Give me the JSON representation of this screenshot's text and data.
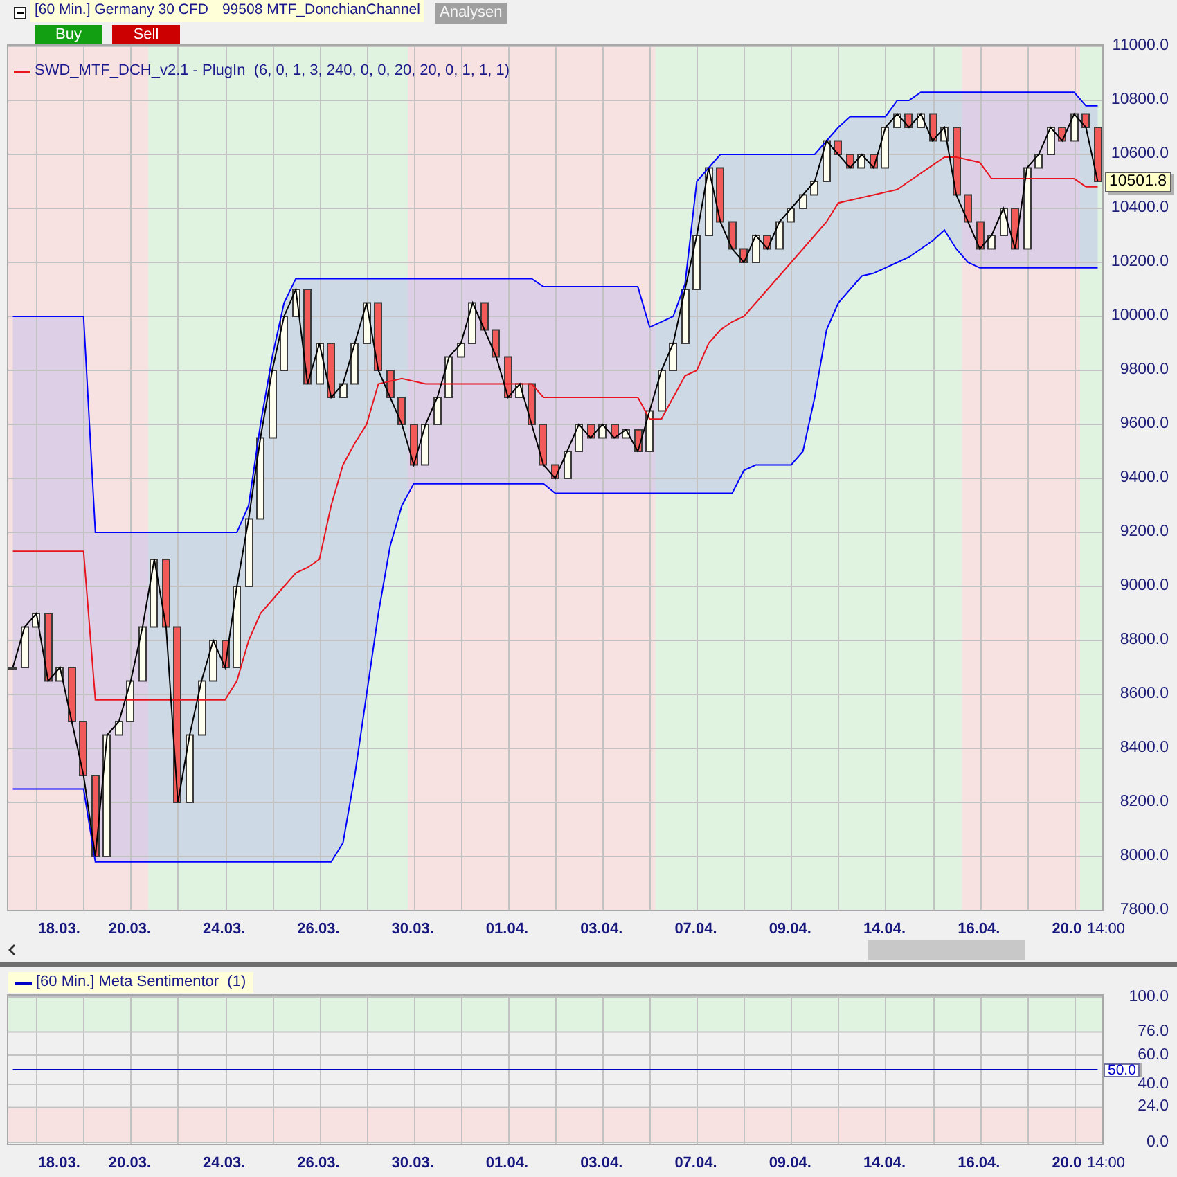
{
  "title_bar": {
    "instrument": "[60 Min.] Germany 30 CFD",
    "template": "99508 MTF_DonchianChannel",
    "analysis_button": "Analysen"
  },
  "order_buttons": [
    {
      "kind": "buy",
      "label": "Buy"
    },
    {
      "kind": "sell",
      "label": "Sell"
    }
  ],
  "price_chart": {
    "legend": "SWD_MTF_DCH_v2.1 - PlugIn  (6, 0, 1, 3, 240, 0, 0, 20, 20, 0, 1, 1, 1)",
    "last_price": "10501.8",
    "time_label": "14:00",
    "chart_data": {
      "type": "line",
      "grid": true,
      "categories": [
        null,
        null,
        null,
        null,
        "18.03.",
        null,
        null,
        null,
        null,
        null,
        "20.03.",
        null,
        null,
        null,
        null,
        null,
        null,
        null,
        "24.03.",
        null,
        null,
        null,
        null,
        null,
        null,
        null,
        "26.03.",
        null,
        null,
        null,
        null,
        null,
        null,
        null,
        "30.03.",
        null,
        null,
        null,
        null,
        null,
        null,
        null,
        "01.04.",
        null,
        null,
        null,
        null,
        null,
        null,
        null,
        "03.04.",
        null,
        null,
        null,
        null,
        null,
        null,
        null,
        "07.04.",
        null,
        null,
        null,
        null,
        null,
        null,
        null,
        "09.04.",
        null,
        null,
        null,
        null,
        null,
        null,
        null,
        "14.04.",
        null,
        null,
        null,
        null,
        null,
        null,
        null,
        "16.04.",
        null,
        null,
        null,
        null,
        null,
        null,
        null,
        "20.0",
        null,
        null
      ],
      "series": [
        {
          "values": [
            8700,
            8850,
            8900,
            8650,
            8700,
            8500,
            8300,
            8000,
            8450,
            8500,
            8650,
            8850,
            9100,
            8850,
            8200,
            8450,
            8650,
            8800,
            8700,
            9000,
            9250,
            9550,
            9800,
            10000,
            10100,
            9750,
            9900,
            9700,
            9750,
            9900,
            10050,
            9800,
            9700,
            9600,
            9450,
            9600,
            9700,
            9850,
            9900,
            10050,
            9950,
            9850,
            9700,
            9750,
            9600,
            9450,
            9400,
            9500,
            9600,
            9550,
            9600,
            9550,
            9580,
            9500,
            9650,
            9800,
            9900,
            10100,
            10300,
            10550,
            10350,
            10250,
            10200,
            10300,
            10250,
            10350,
            10400,
            10450,
            10500,
            10650,
            10600,
            10550,
            10600,
            10550,
            10700,
            10750,
            10700,
            10750,
            10650,
            10700,
            10450,
            10350,
            10250,
            10300,
            10400,
            10250,
            10550,
            10600,
            10700,
            10650,
            10750,
            10700,
            10500
          ]
        },
        {
          "color": "#0000ff",
          "values": [
            10000,
            10000,
            10000,
            10000,
            10000,
            10000,
            10000,
            9200,
            9200,
            9200,
            9200,
            9200,
            9200,
            9200,
            9200,
            9200,
            9200,
            9200,
            9200,
            9200,
            9300,
            9600,
            9850,
            10050,
            10140,
            10140,
            10140,
            10140,
            10140,
            10140,
            10140,
            10140,
            10140,
            10140,
            10140,
            10140,
            10140,
            10140,
            10140,
            10140,
            10140,
            10140,
            10140,
            10140,
            10140,
            10110,
            10110,
            10110,
            10110,
            10110,
            10110,
            10110,
            10110,
            10110,
            9960,
            9980,
            10000,
            10120,
            10500,
            10550,
            10600,
            10600,
            10600,
            10600,
            10600,
            10600,
            10600,
            10600,
            10600,
            10650,
            10700,
            10740,
            10740,
            10740,
            10740,
            10800,
            10800,
            10830,
            10830,
            10830,
            10830,
            10830,
            10830,
            10830,
            10830,
            10830,
            10830,
            10830,
            10830,
            10830,
            10830,
            10780,
            10780
          ]
        },
        {
          "color": "#e8141e",
          "values": [
            9130,
            9130,
            9130,
            9130,
            9130,
            9130,
            9130,
            8580,
            8580,
            8580,
            8580,
            8580,
            8580,
            8580,
            8580,
            8580,
            8580,
            8580,
            8580,
            8650,
            8800,
            8900,
            8950,
            9000,
            9050,
            9070,
            9100,
            9300,
            9450,
            9530,
            9600,
            9750,
            9760,
            9770,
            9760,
            9750,
            9750,
            9750,
            9750,
            9750,
            9750,
            9750,
            9750,
            9750,
            9750,
            9700,
            9700,
            9700,
            9700,
            9700,
            9700,
            9700,
            9700,
            9700,
            9620,
            9620,
            9700,
            9780,
            9800,
            9900,
            9950,
            9980,
            10000,
            10050,
            10100,
            10150,
            10200,
            10250,
            10300,
            10350,
            10420,
            10430,
            10440,
            10450,
            10460,
            10470,
            10500,
            10530,
            10560,
            10590,
            10590,
            10580,
            10570,
            10510,
            10510,
            10510,
            10510,
            10510,
            10510,
            10510,
            10510,
            10480,
            10480
          ]
        },
        {
          "color": "#0000ff",
          "values": [
            8250,
            8250,
            8250,
            8250,
            8250,
            8250,
            8250,
            7980,
            7980,
            7980,
            7980,
            7980,
            7980,
            7980,
            7980,
            7980,
            7980,
            7980,
            7980,
            7980,
            7980,
            7980,
            7980,
            7980,
            7980,
            7980,
            7980,
            7980,
            8050,
            8300,
            8600,
            8900,
            9150,
            9300,
            9380,
            9380,
            9380,
            9380,
            9380,
            9380,
            9380,
            9380,
            9380,
            9380,
            9380,
            9380,
            9345,
            9345,
            9345,
            9345,
            9345,
            9345,
            9345,
            9345,
            9345,
            9345,
            9345,
            9345,
            9345,
            9345,
            9345,
            9345,
            9430,
            9450,
            9450,
            9450,
            9450,
            9500,
            9700,
            9950,
            10050,
            10100,
            10150,
            10160,
            10180,
            10200,
            10220,
            10250,
            10280,
            10320,
            10250,
            10200,
            10180,
            10180,
            10180,
            10180,
            10180,
            10180,
            10180,
            10180,
            10180,
            10180,
            10180
          ]
        }
      ],
      "ylim": [
        7800,
        11000
      ],
      "yticks": [
        {
          "value": 11000,
          "label": "11000.0"
        },
        {
          "value": 10800,
          "label": "10800.0"
        },
        {
          "value": 10600,
          "label": "10600.0"
        },
        {
          "value": 10400,
          "label": "10400.0"
        },
        {
          "value": 10200,
          "label": "10200.0"
        },
        {
          "value": 10000,
          "label": "10000.0"
        },
        {
          "value": 9800,
          "label": "9800.0"
        },
        {
          "value": 9600,
          "label": "9600.0"
        },
        {
          "value": 9400,
          "label": "9400.0"
        },
        {
          "value": 9200,
          "label": "9200.0"
        },
        {
          "value": 9000,
          "label": "9000.0"
        },
        {
          "value": 8800,
          "label": "8800.0"
        },
        {
          "value": 8600,
          "label": "8600.0"
        },
        {
          "value": 8400,
          "label": "8400.0"
        },
        {
          "value": 8200,
          "label": "8200.0"
        },
        {
          "value": 8000,
          "label": "8000.0"
        },
        {
          "value": 7800,
          "label": "7800.0"
        }
      ]
    }
  },
  "sentiment_panel": {
    "legend": "[60 Min.] Meta Sentimentor  (1)",
    "current_value": "50.0",
    "time_label": "14:00",
    "chart_data": {
      "type": "line",
      "grid": true,
      "categories": [
        null,
        null,
        null,
        null,
        "18.03.",
        null,
        null,
        null,
        null,
        null,
        "20.03.",
        null,
        null,
        null,
        null,
        null,
        null,
        null,
        "24.03.",
        null,
        null,
        null,
        null,
        null,
        null,
        null,
        "26.03.",
        null,
        null,
        null,
        null,
        null,
        null,
        null,
        "30.03.",
        null,
        null,
        null,
        null,
        null,
        null,
        null,
        "01.04.",
        null,
        null,
        null,
        null,
        null,
        null,
        null,
        "03.04.",
        null,
        null,
        null,
        null,
        null,
        null,
        null,
        "07.04.",
        null,
        null,
        null,
        null,
        null,
        null,
        null,
        "09.04.",
        null,
        null,
        null,
        null,
        null,
        null,
        null,
        "14.04.",
        null,
        null,
        null,
        null,
        null,
        null,
        null,
        "16.04.",
        null,
        null,
        null,
        null,
        null,
        null,
        null,
        "20.0",
        null,
        null
      ],
      "series": [
        {
          "color": "#0000c8",
          "values": [
            50,
            50,
            50,
            50,
            50,
            50,
            50,
            50,
            50,
            50,
            50,
            50,
            50,
            50,
            50,
            50,
            50,
            50,
            50,
            50,
            50,
            50,
            50,
            50,
            50,
            50,
            50,
            50,
            50,
            50,
            50,
            50,
            50,
            50,
            50,
            50,
            50,
            50,
            50,
            50,
            50,
            50,
            50,
            50,
            50,
            50,
            50,
            50,
            50,
            50,
            50,
            50,
            50,
            50,
            50,
            50,
            50,
            50,
            50,
            50,
            50,
            50,
            50,
            50,
            50,
            50,
            50,
            50,
            50,
            50,
            50,
            50,
            50,
            50,
            50,
            50,
            50,
            50,
            50,
            50,
            50,
            50,
            50,
            50,
            50,
            50,
            50,
            50,
            50,
            50,
            50,
            50,
            50
          ]
        }
      ],
      "bands": [
        {
          "axis": "y",
          "from": 76,
          "to": 100,
          "color": "#e0f2e0"
        },
        {
          "axis": "y",
          "from": 0,
          "to": 24,
          "color": "#f8e1e1"
        }
      ],
      "ylim": [
        0,
        100
      ],
      "yticks": [
        {
          "value": 100,
          "label": "100.0"
        },
        {
          "value": 76,
          "label": "76.0"
        },
        {
          "value": 60,
          "label": "60.0"
        },
        {
          "value": 40,
          "label": "40.0"
        },
        {
          "value": 24,
          "label": "24.0"
        },
        {
          "value": 0,
          "label": "0.0"
        }
      ]
    }
  }
}
